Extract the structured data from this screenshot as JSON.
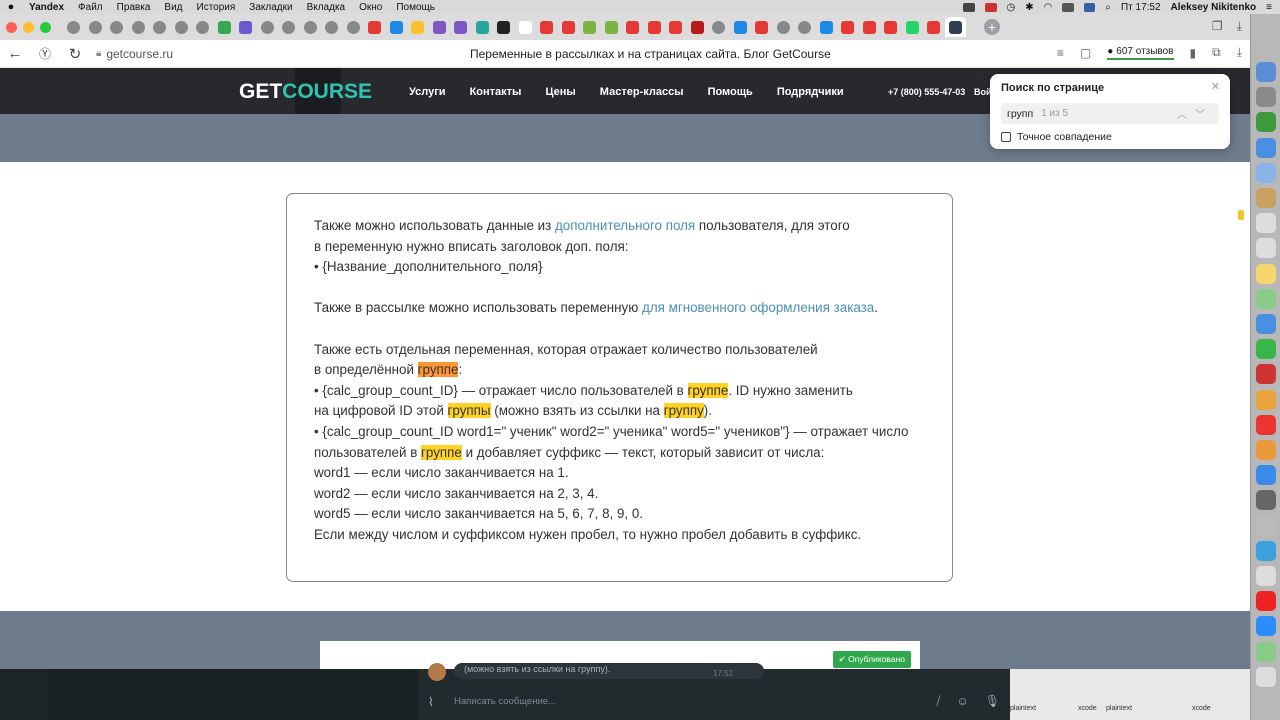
{
  "menubar": {
    "app_name": "Yandex",
    "menus": [
      "Файл",
      "Правка",
      "Вид",
      "История",
      "Закладки",
      "Вкладка",
      "Окно",
      "Помощь"
    ],
    "clock": "Пт 17:52",
    "user": "Aleksey Nikitenko"
  },
  "browser": {
    "url": "getcourse.ru",
    "page_title": "Переменные в рассылках и на страницах сайта. Блог GetCourse",
    "reviews": "607 отзывов"
  },
  "site": {
    "logo_get": "GET",
    "logo_course": "COURSE",
    "nav": [
      "Услуги",
      "Контакты",
      "Цены",
      "Мастер-классы",
      "Помощь",
      "Подрядчики"
    ],
    "phone": "+7 (800) 555-47-03",
    "login": "Вой"
  },
  "content": {
    "p1_a": "Также можно использовать данные из ",
    "p1_link": "дополнительного поля",
    "p1_b": " пользователя, для этого",
    "p2": "в переменную нужно вписать заголовок доп. поля:",
    "p3": "• {Название_дополнительного_поля}",
    "p4_a": "Также в рассылке можно использовать переменную ",
    "p4_link": "для мгновенного оформления заказа",
    "p4_b": ".",
    "p5": "Также есть отдельная переменная, которая отражает количество пользователей",
    "p6_a": "в определённой ",
    "p6_hl": "группе",
    "p6_b": ":",
    "p7_a": "• {calc_group_count_ID} — отражает число пользователей в ",
    "p7_hl": "группе",
    "p7_b": ". ID нужно заменить",
    "p8_a": "на цифровой ID этой ",
    "p8_hl": "группы",
    "p8_b": " (можно взять из ссылки на ",
    "p8_hl2": "группу",
    "p8_c": ").",
    "p9": "• {calc_group_count_ID word1=\" ученик\" word2=\" ученика\" word5=\" учеников\"} — отражает число",
    "p10_a": "пользователей в ",
    "p10_hl": "группе",
    "p10_b": " и добавляет суффикс — текст, который зависит от числа:",
    "p11": "word1 — если число заканчивается на 1.",
    "p12": "word2 — если число заканчивается на 2, 3, 4.",
    "p13": "word5 — если число заканчивается на 5, 6, 7, 8, 9, 0.",
    "p14": "Если между числом и суффиксом нужен пробел, то нужно пробел добавить в суффикс."
  },
  "published_badge": "✔ Опубликовано",
  "findbar": {
    "title": "Поиск по странице",
    "query": "групп",
    "count": "1 из 5",
    "exact_match_label": "Точное совпадение",
    "exact_match_checked": false
  },
  "telegram": {
    "message_preview": "(можно взять из ссылки на группу).",
    "message_time": "17:52",
    "input_placeholder": "Написать сообщение...",
    "side_labels": [
      "plaintext",
      "xcode",
      "plaintext",
      "xcode"
    ]
  },
  "colors": {
    "accent_teal": "#2fc4b2",
    "link": "#4a8fb8",
    "highlight": "#ffd224",
    "highlight_current": "#ff9632",
    "header_bg": "#27292d",
    "band_bg": "#6e7b8c"
  }
}
